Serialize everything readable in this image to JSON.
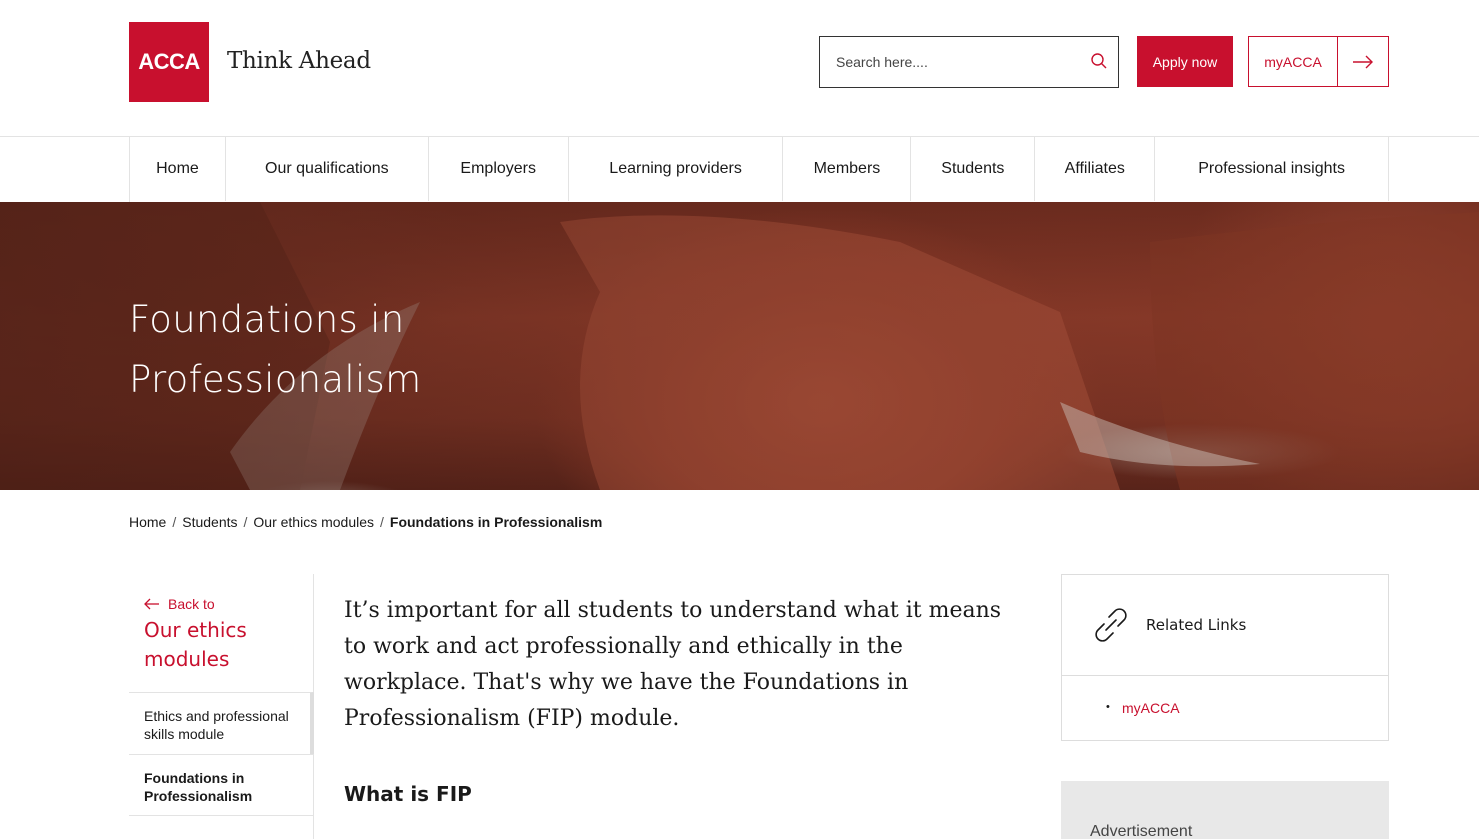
{
  "header": {
    "logo_text": "ACCA",
    "tagline": "Think Ahead",
    "search_placeholder": "Search here....",
    "apply_label": "Apply now",
    "myacca_label": "myACCA"
  },
  "nav": {
    "items": [
      {
        "label": "Home"
      },
      {
        "label": "Our qualifications"
      },
      {
        "label": "Employers"
      },
      {
        "label": "Learning providers"
      },
      {
        "label": "Members"
      },
      {
        "label": "Students"
      },
      {
        "label": "Affiliates"
      },
      {
        "label": "Professional insights"
      }
    ]
  },
  "hero": {
    "title": "Foundations in Professionalism"
  },
  "breadcrumb": {
    "items": [
      "Home",
      "Students",
      "Our ethics modules"
    ],
    "current": "Foundations in Professionalism",
    "separator": "/"
  },
  "left_nav": {
    "back_label": "Back to",
    "back_title": "Our ethics modules",
    "items": [
      {
        "label": "Ethics and professional skills module"
      },
      {
        "label": "Foundations in Professionalism"
      }
    ]
  },
  "main": {
    "intro": "It’s important for all students to understand what it means to work and act professionally and ethically in the workplace. That's why we have the Foundations in Professionalism (FIP) module.",
    "heading": "What is FIP"
  },
  "sidebar": {
    "related_title": "Related Links",
    "related_links": [
      {
        "label": "myACCA"
      }
    ],
    "advert_label": "Advertisement"
  },
  "colors": {
    "brand": "#c8102e"
  }
}
